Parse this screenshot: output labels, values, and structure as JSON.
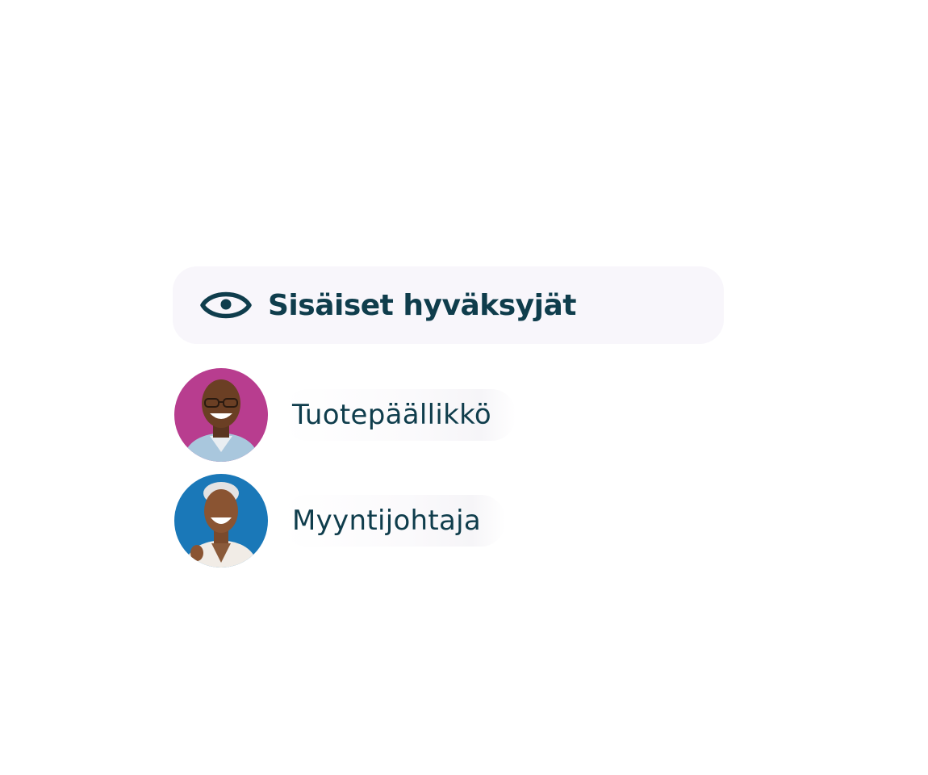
{
  "header": {
    "title": "Sisäiset hyväksyjät",
    "icon": "eye-icon"
  },
  "approvers": [
    {
      "role": "Tuotepäällikkö",
      "avatar_bg": "#b83d8f"
    },
    {
      "role": "Myyntijohtaja",
      "avatar_bg": "#1a78b8"
    }
  ],
  "colors": {
    "text": "#0f3d4c",
    "card_bg": "#f8f6fb"
  }
}
